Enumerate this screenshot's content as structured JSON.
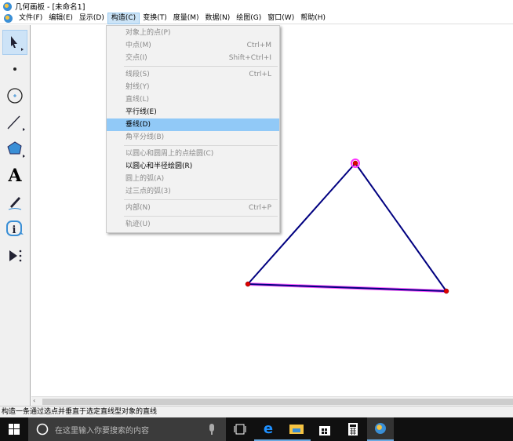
{
  "window": {
    "title": "几何画板 - [未命名1]"
  },
  "menubar": [
    "文件(F)",
    "编辑(E)",
    "显示(D)",
    "构造(C)",
    "变换(T)",
    "度量(M)",
    "数据(N)",
    "绘图(G)",
    "窗口(W)",
    "帮助(H)"
  ],
  "toolbar": {
    "tools": [
      "arrow-select-tool",
      "point-tool",
      "compass-tool",
      "straightedge-tool",
      "polygon-tool",
      "text-tool",
      "marker-tool",
      "information-tool",
      "custom-tool"
    ]
  },
  "construct_menu": {
    "groups": [
      [
        {
          "label": "对象上的点(P)",
          "shortcut": "",
          "enabled": false
        },
        {
          "label": "中点(M)",
          "shortcut": "Ctrl+M",
          "enabled": false
        },
        {
          "label": "交点(I)",
          "shortcut": "Shift+Ctrl+I",
          "enabled": false
        }
      ],
      [
        {
          "label": "线段(S)",
          "shortcut": "Ctrl+L",
          "enabled": false
        },
        {
          "label": "射线(Y)",
          "shortcut": "",
          "enabled": false
        },
        {
          "label": "直线(L)",
          "shortcut": "",
          "enabled": false
        },
        {
          "label": "平行线(E)",
          "shortcut": "",
          "enabled": true
        },
        {
          "label": "垂线(D)",
          "shortcut": "",
          "enabled": true,
          "highlighted": true
        },
        {
          "label": "角平分线(B)",
          "shortcut": "",
          "enabled": false
        }
      ],
      [
        {
          "label": "以圆心和圆周上的点绘圆(C)",
          "shortcut": "",
          "enabled": false
        },
        {
          "label": "以圆心和半径绘圆(R)",
          "shortcut": "",
          "enabled": true
        },
        {
          "label": "圆上的弧(A)",
          "shortcut": "",
          "enabled": false
        },
        {
          "label": "过三点的弧(3)",
          "shortcut": "",
          "enabled": false
        }
      ],
      [
        {
          "label": "内部(N)",
          "shortcut": "Ctrl+P",
          "enabled": false
        }
      ],
      [
        {
          "label": "轨迹(U)",
          "shortcut": "",
          "enabled": false
        }
      ]
    ]
  },
  "status_bar": "构造一条通过选点并垂直于选定直线型对象的直线",
  "taskbar": {
    "search_placeholder": "在这里输入你要搜索的内容"
  },
  "colors": {
    "segment": "#000080",
    "point": "#e00000",
    "selection": "#ff33ff",
    "menu_highlight": "#91c9f7"
  }
}
